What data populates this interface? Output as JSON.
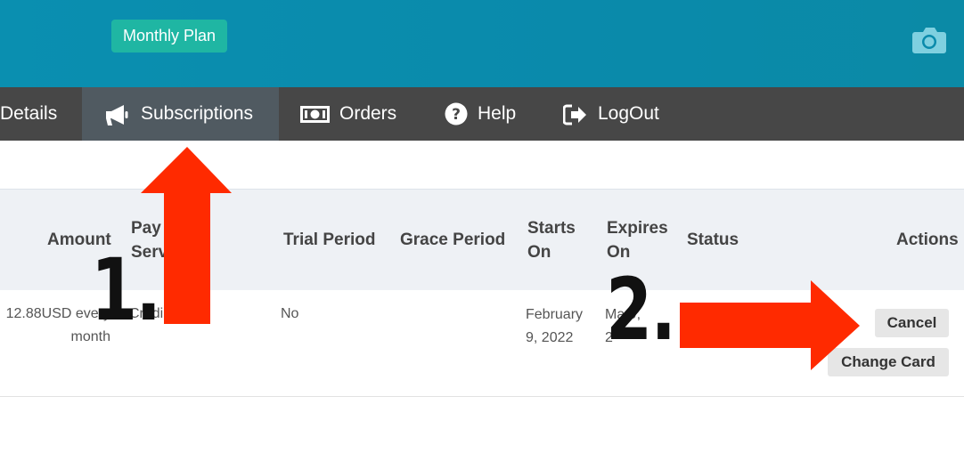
{
  "header": {
    "plan_badge": "Monthly Plan",
    "camera_icon": "camera-icon",
    "background_color": "#0a8fb0",
    "badge_color": "#1fb6a3"
  },
  "nav": {
    "background_color": "#474747",
    "active_color": "#505a61",
    "items": [
      {
        "label": "Details",
        "icon": null,
        "active": false
      },
      {
        "label": "Subscriptions",
        "icon": "megaphone-icon",
        "active": true
      },
      {
        "label": "Orders",
        "icon": "money-icon",
        "active": false
      },
      {
        "label": "Help",
        "icon": "question-circle-icon",
        "active": false
      },
      {
        "label": "LogOut",
        "icon": "logout-icon",
        "active": false
      }
    ]
  },
  "table": {
    "headers": {
      "amount": "Amount",
      "payment_service_1": "Pay",
      "payment_service_2": "Serv",
      "trial_period": "Trial Period",
      "grace_period": "Grace Period",
      "starts_on_1": "Starts",
      "starts_on_2": "On",
      "expires_on_1": "Expires",
      "expires_on_2": "On",
      "status": "Status",
      "actions": "Actions"
    },
    "row": {
      "amount_1": "12.88USD every",
      "amount_2": "month",
      "payment_service": "Credi",
      "trial_period": "No",
      "grace_period": "",
      "starts_on_1": "February",
      "starts_on_2": "9, 2022",
      "expires_on_1": "Ma 9,",
      "expires_on_2": "2",
      "status": "",
      "cancel_label": "Cancel",
      "change_card_label": "Change Card"
    }
  },
  "annotations": {
    "step1": "1.",
    "step2": "2.",
    "arrow_color": "#ff2a00"
  }
}
